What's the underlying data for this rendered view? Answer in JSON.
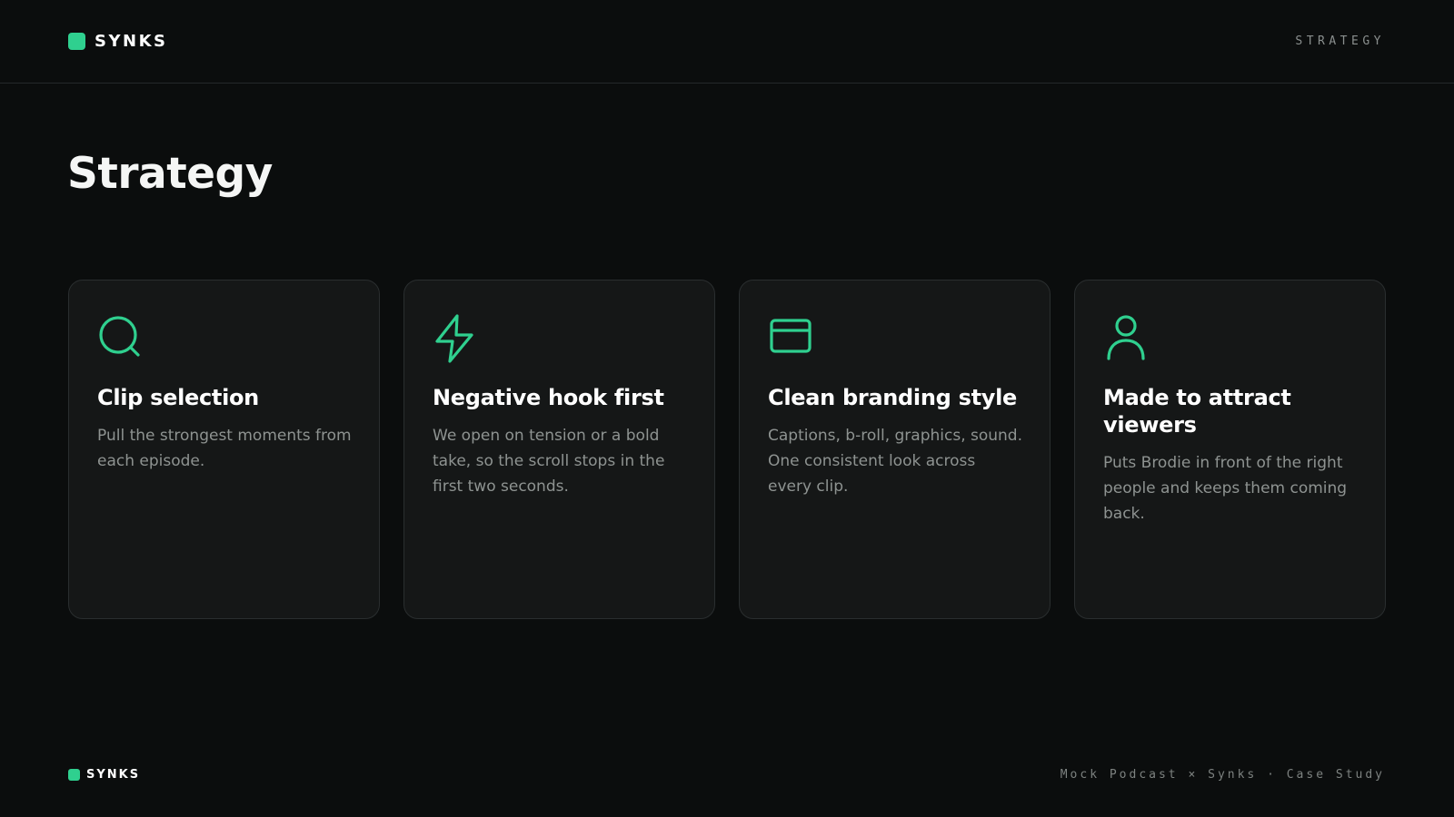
{
  "header": {
    "brand": "SYNKS",
    "section_label": "STRATEGY"
  },
  "main": {
    "title": "Strategy",
    "cards": [
      {
        "icon": "search-icon",
        "title": "Clip selection",
        "body": "Pull the strongest moments from each episode."
      },
      {
        "icon": "lightning-icon",
        "title": "Negative hook first",
        "body": "We open on tension or a bold take, so the scroll stops in the first two seconds."
      },
      {
        "icon": "window-icon",
        "title": "Clean branding style",
        "body": "Captions, b-roll, graphics, sound. One consistent look across every clip."
      },
      {
        "icon": "user-icon",
        "title": "Made to attract viewers",
        "body": "Puts Brodie in front of the right people and keeps them coming back."
      }
    ]
  },
  "footer": {
    "brand": "SYNKS",
    "caption": "Mock Podcast × Synks · Case Study"
  },
  "colors": {
    "background": "#0b0d0d",
    "card_background": "#151717",
    "accent": "#2fd08f",
    "muted_text": "#8e9391"
  }
}
